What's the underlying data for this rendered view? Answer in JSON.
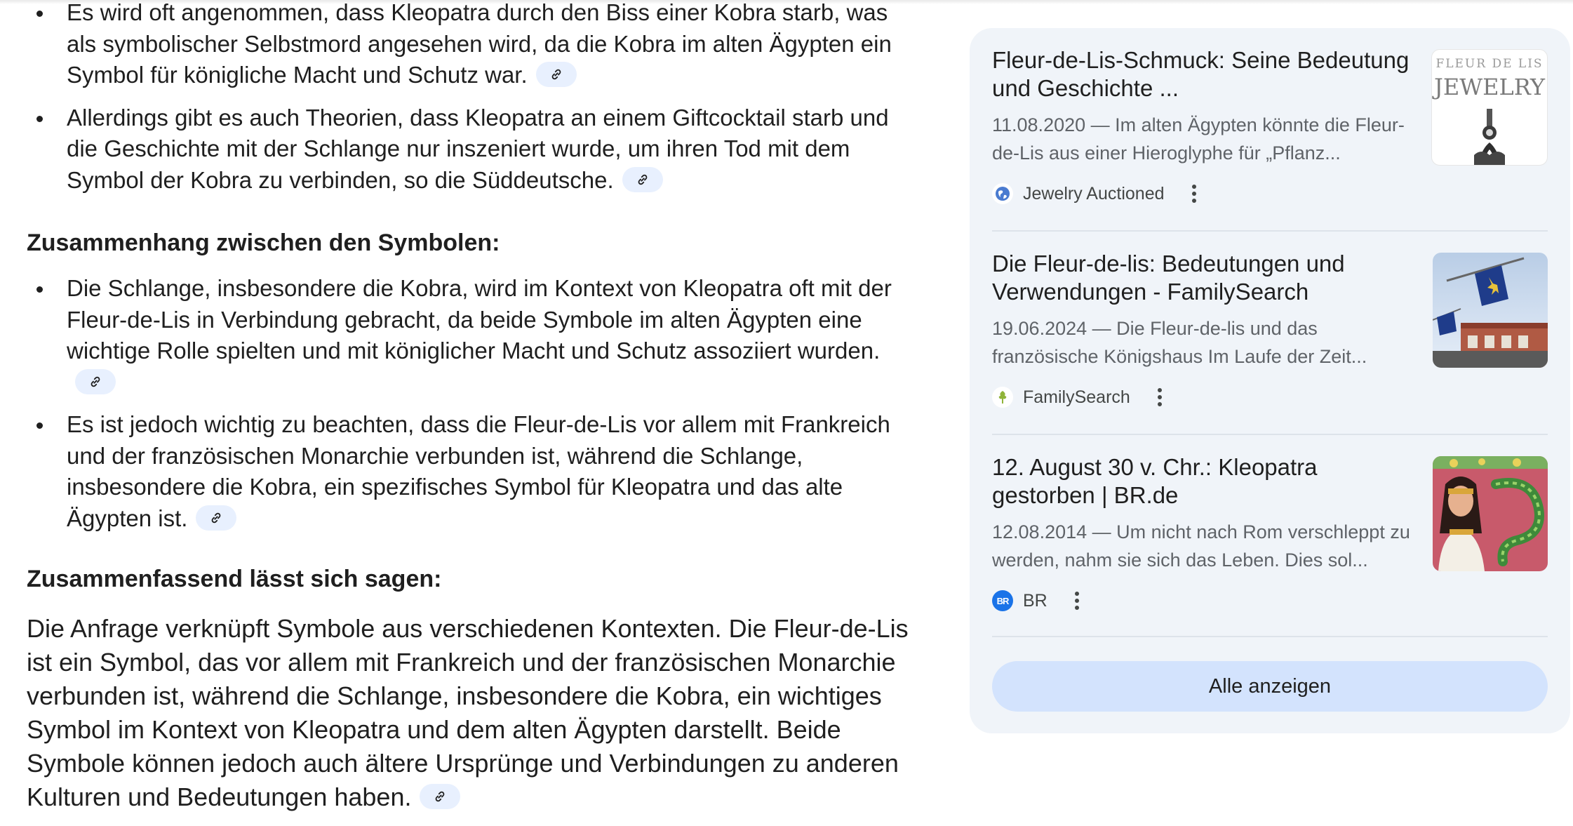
{
  "answer": {
    "bullets_top": [
      "Es wird oft angenommen, dass Kleopatra durch den Biss einer Kobra starb, was als symbolischer Selbstmord angesehen wird, da die Kobra im alten Ägypten ein Symbol für königliche Macht und Schutz war.",
      "Allerdings gibt es auch Theorien, dass Kleopatra an einem Giftcocktail starb und die Geschichte mit der Schlange nur inszeniert wurde, um ihren Tod mit dem Symbol der Kobra zu verbinden, so die Süddeutsche."
    ],
    "heading_connection": "Zusammenhang zwischen den Symbolen:",
    "bullets_connection": [
      "Die Schlange, insbesondere die Kobra, wird im Kontext von Kleopatra oft mit der Fleur-de-Lis in Verbindung gebracht, da beide Symbole im alten Ägypten eine wichtige Rolle spielten und mit königlicher Macht und Schutz assoziiert wurden.",
      "Es ist jedoch wichtig zu beachten, dass die Fleur-de-Lis vor allem mit Frankreich und der französischen Monarchie verbunden ist, während die Schlange, insbesondere die Kobra, ein spezifisches Symbol für Kleopatra und das alte Ägypten ist."
    ],
    "heading_summary": "Zusammenfassend lässt sich sagen:",
    "summary": "Die Anfrage verknüpft Symbole aus verschiedenen Kontexten. Die Fleur-de-Lis ist ein Symbol, das vor allem mit Frankreich und der französischen Monarchie verbunden ist, während die Schlange, insbesondere die Kobra, ein wichtiges Symbol im Kontext von Kleopatra und dem alten Ägypten darstellt. Beide Symbole können jedoch auch ältere Ursprünge und Verbindungen zu anderen Kulturen und Bedeutungen haben."
  },
  "sources": {
    "cards": [
      {
        "title": "Fleur-de-Lis-Schmuck: Seine Bedeutung und Geschichte ...",
        "date": "11.08.2020",
        "snippet": "Im alten Ägypten könnte die Fleur-de-Lis aus einer Hieroglyphe für „Pflanz...",
        "source": "Jewelry Auctioned",
        "thumb_text_1": "FLEUR DE LIS",
        "thumb_text_2": "JEWELRY"
      },
      {
        "title": "Die Fleur-de-lis: Bedeutungen und Verwendungen - FamilySearch",
        "date": "19.06.2024",
        "snippet": "Die Fleur-de-lis und das französische Königshaus Im Laufe der Zeit...",
        "source": "FamilySearch"
      },
      {
        "title": "12. August 30 v. Chr.: Kleopatra gestorben | BR.de",
        "date": "12.08.2014",
        "snippet": "Um nicht nach Rom verschleppt zu werden, nahm sie sich das Leben. Dies sol...",
        "source": "BR",
        "favicon_text": "BR"
      }
    ],
    "date_separator": "—",
    "show_all": "Alle anzeigen"
  },
  "colors": {
    "panel_bg": "#f0f4f9",
    "link_chip_bg": "#e8f0fe",
    "button_bg": "#d3e3fd",
    "br_brand": "#1a73e8"
  }
}
